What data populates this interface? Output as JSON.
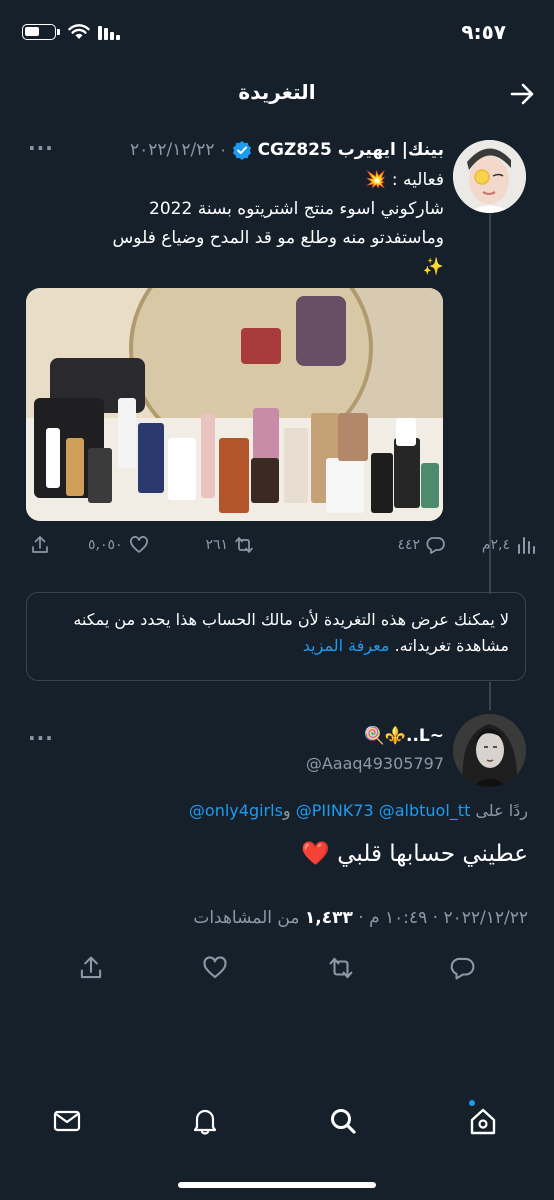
{
  "status_bar": {
    "time": "٩:٥٧"
  },
  "header": {
    "title": "التغريدة"
  },
  "tweet": {
    "display_name": "بينك| ايهيرب CGZ825",
    "date": "٢٠٢٢/١٢/٢٢",
    "text_line1": "فعاليه : 💥",
    "text_line2": "شاركوني اسوء منتج اشتريتوه بسنة 2022",
    "text_line3": "وماستفدتو منه وطلع مو قد المدح وضياع فلوس",
    "text_line4": "✨",
    "stats": {
      "views": "٢,٤م",
      "replies": "٤٤٢",
      "retweets": "٢٦١",
      "likes": "٥,٠٥٠"
    }
  },
  "notice": {
    "text": "لا يمكنك عرض هذه التغريدة لأن مالك الحساب هذا يحدد من يمكنه مشاهدة تغريداته.",
    "link": "معرفة المزيد"
  },
  "reply": {
    "display_name": "🍭⚜️..L~",
    "handle": "@Aaaq49305797",
    "replying_prefix": "ردًا على",
    "mention1": "@albtuol_tt",
    "mention2": "@PIINK73",
    "mention3_prefix": "و",
    "mention3": "@only4girls",
    "text": "عطيني حسابها قلبي ❤️",
    "date": "٢٠٢٢/١٢/٢٢",
    "time": "١٠:٤٩ م",
    "views_count": "١,٤٣٣",
    "views_label": "من المشاهدات"
  },
  "colors": {
    "background": "#15202b",
    "accent": "#1d9bf0",
    "muted": "#8b98a5",
    "border": "#38444d"
  }
}
